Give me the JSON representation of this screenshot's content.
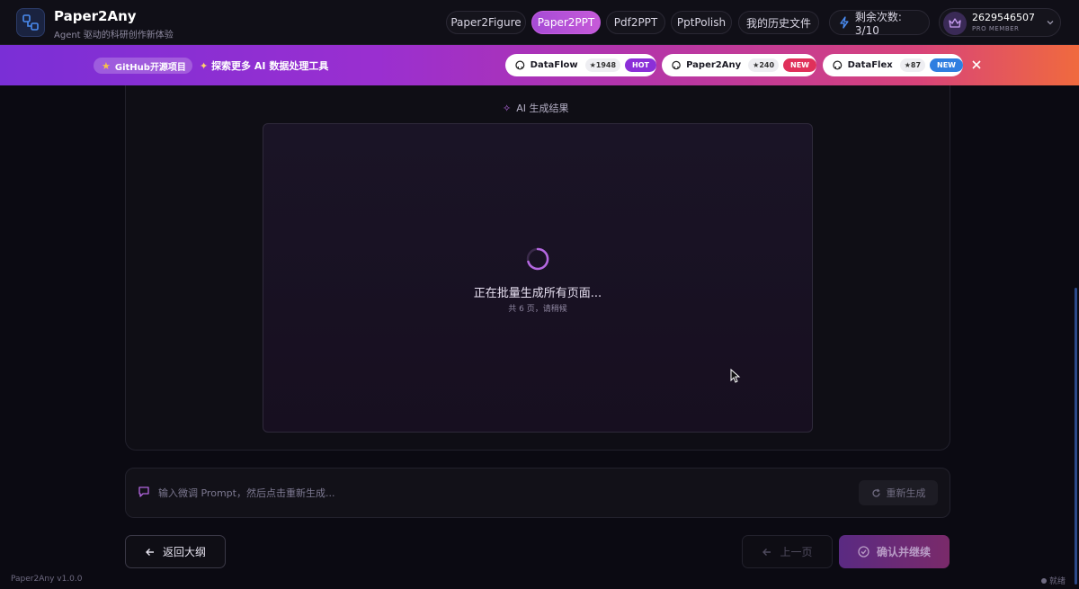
{
  "app": {
    "name": "Paper2Any",
    "subtitle": "Agent 驱动的科研创作新体验",
    "version": "Paper2Any v1.0.0",
    "status": "就绪"
  },
  "nav": {
    "items": [
      {
        "label": "Paper2Figure",
        "active": false
      },
      {
        "label": "Paper2PPT",
        "active": true
      },
      {
        "label": "Pdf2PPT",
        "active": false
      },
      {
        "label": "PptPolish",
        "active": false
      },
      {
        "label": "我的历史文件",
        "active": false
      }
    ],
    "quota_label": "剩余次数: 3/10",
    "user_id": "2629546507",
    "user_tier": "PRO MEMBER"
  },
  "banner": {
    "github_label": "GitHub开源项目",
    "explore_label": "探索更多 AI 数据处理工具",
    "repos": [
      {
        "name": "DataFlow",
        "stars": "★1948",
        "tag": "HOT",
        "tag_color": "#8b2fd8"
      },
      {
        "name": "Paper2Any",
        "stars": "★240",
        "tag": "NEW",
        "tag_color": "#e0305a"
      },
      {
        "name": "DataFlex",
        "stars": "★87",
        "tag": "NEW",
        "tag_color": "#2f7ee0"
      }
    ]
  },
  "result": {
    "title": "AI 生成结果",
    "loading_text": "正在批量生成所有页面...",
    "loading_sub": "共 6 页，请稍候"
  },
  "prompt": {
    "placeholder": "输入微调 Prompt，然后点击重新生成...",
    "value": "",
    "regen_label": "重新生成"
  },
  "actions": {
    "back_label": "返回大纲",
    "prev_label": "上一页",
    "confirm_label": "确认并继续"
  },
  "colors": {
    "accent": "#c65ad8",
    "spinner": "#b467e0"
  }
}
